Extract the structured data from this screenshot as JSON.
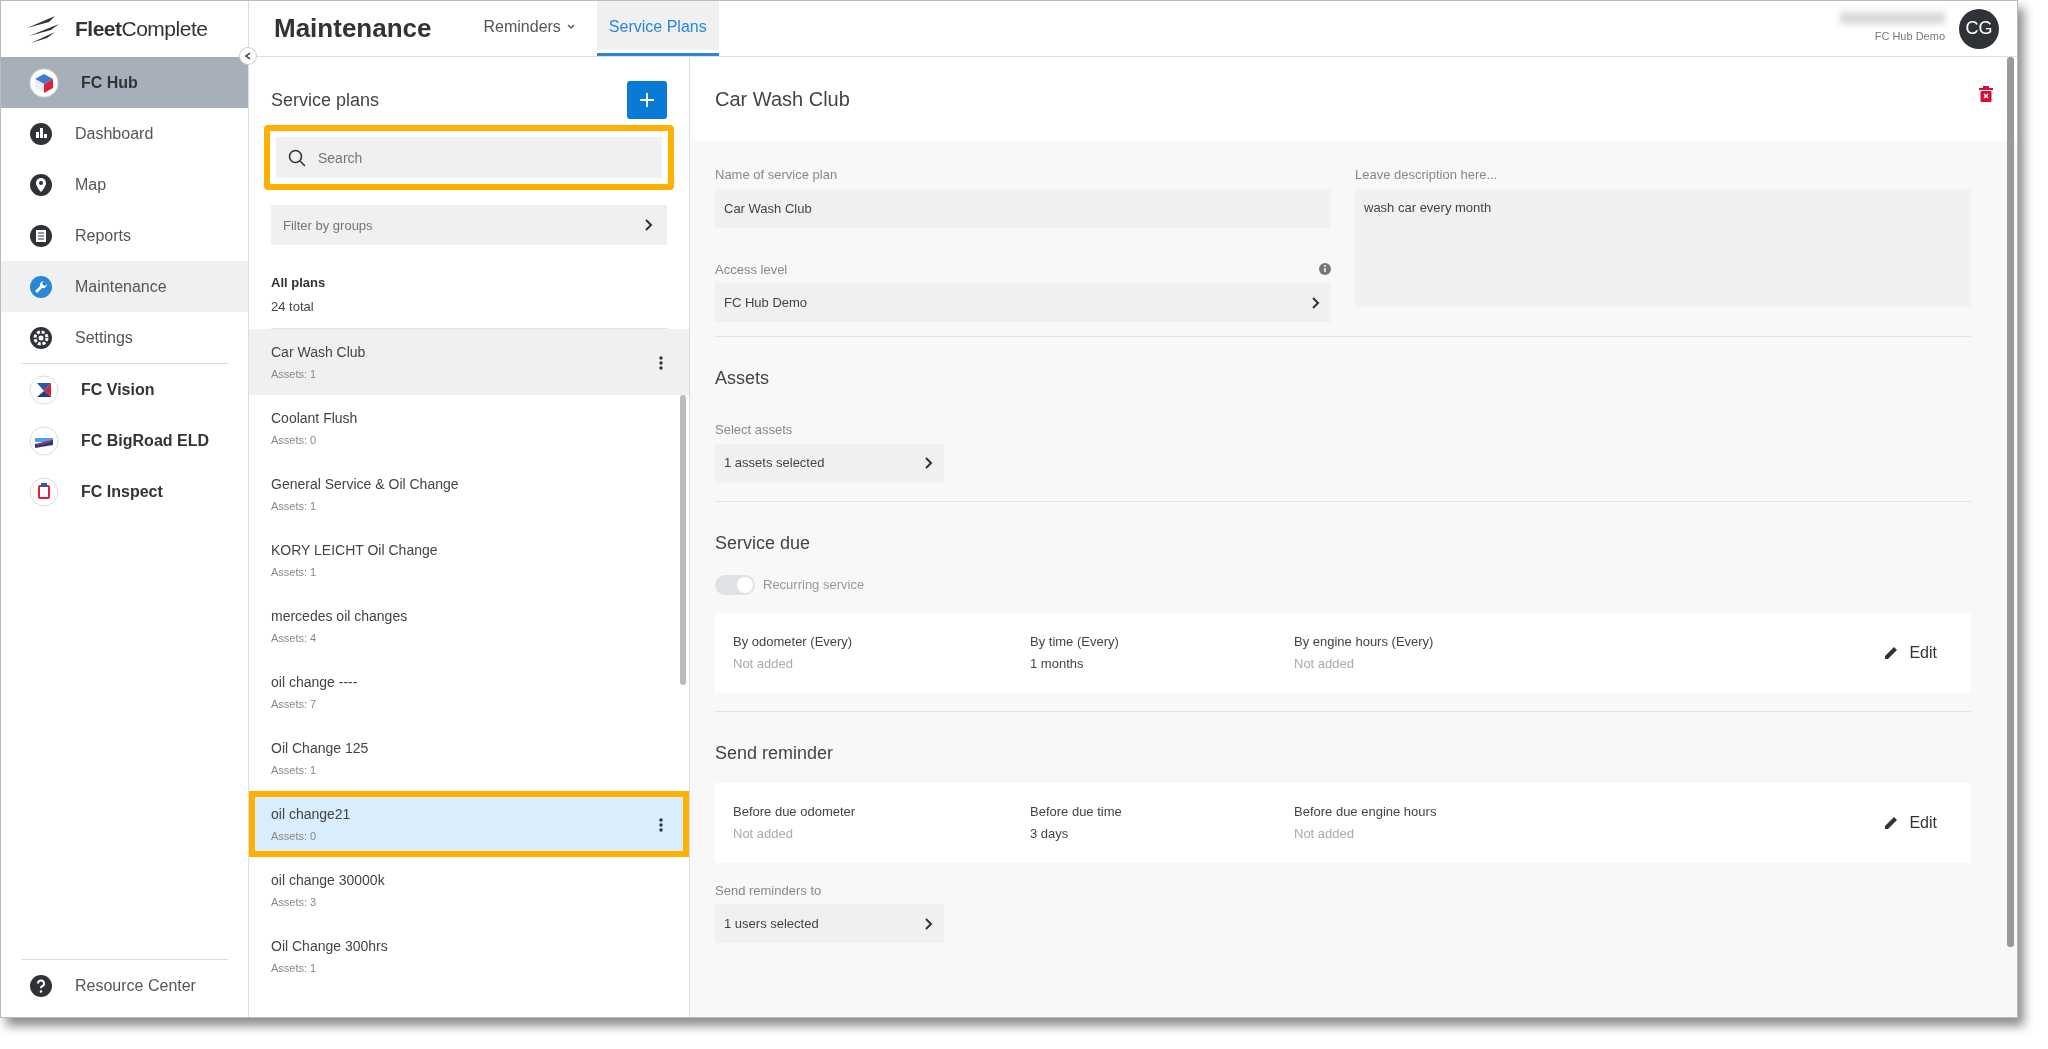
{
  "brand": {
    "name": "**Fleet**Complete"
  },
  "sidebar": {
    "items": [
      {
        "label": "FC Hub",
        "kind": "app",
        "selected": true
      },
      {
        "label": "Dashboard",
        "kind": "nav",
        "selected": false
      },
      {
        "label": "Map",
        "kind": "nav",
        "selected": false
      },
      {
        "label": "Reports",
        "kind": "nav",
        "selected": false
      },
      {
        "label": "Maintenance",
        "kind": "nav",
        "selected": true
      },
      {
        "label": "Settings",
        "kind": "nav",
        "selected": false
      },
      {
        "label": "FC Vision",
        "kind": "app",
        "selected": false
      },
      {
        "label": "FC BigRoad ELD",
        "kind": "app",
        "selected": false
      },
      {
        "label": "FC Inspect",
        "kind": "app",
        "selected": false
      }
    ],
    "footer": {
      "label": "Resource Center"
    }
  },
  "header": {
    "title": "Maintenance",
    "tabs": [
      {
        "label": "Reminders",
        "dropdown": true,
        "selected": false
      },
      {
        "label": "Service Plans",
        "dropdown": false,
        "selected": true
      }
    ],
    "user": {
      "org": "FC Hub Demo",
      "initials": "CG"
    }
  },
  "plans_panel": {
    "title": "Service plans",
    "search": {
      "placeholder": "Search",
      "outlined": true
    },
    "filter": {
      "placeholder": "Filter by groups"
    },
    "summary": {
      "title": "All plans",
      "total": "24 total"
    },
    "plans": [
      {
        "name": "Car Wash Club",
        "assets": "Assets: 1",
        "selected": true,
        "hovered": false,
        "outlined": false
      },
      {
        "name": "Coolant Flush",
        "assets": "Assets: 0",
        "selected": false,
        "hovered": false,
        "outlined": false
      },
      {
        "name": "General Service & Oil Change",
        "assets": "Assets: 1",
        "selected": false,
        "hovered": false,
        "outlined": false
      },
      {
        "name": "KORY LEICHT Oil Change",
        "assets": "Assets: 1",
        "selected": false,
        "hovered": false,
        "outlined": false
      },
      {
        "name": "mercedes oil changes",
        "assets": "Assets: 4",
        "selected": false,
        "hovered": false,
        "outlined": false
      },
      {
        "name": "oil change ----",
        "assets": "Assets: 7",
        "selected": false,
        "hovered": false,
        "outlined": false
      },
      {
        "name": "Oil Change 125",
        "assets": "Assets: 1",
        "selected": false,
        "hovered": false,
        "outlined": false
      },
      {
        "name": "oil change21",
        "assets": "Assets: 0",
        "selected": false,
        "hovered": true,
        "outlined": true
      },
      {
        "name": "oil change 30000k",
        "assets": "Assets: 3",
        "selected": false,
        "hovered": false,
        "outlined": false
      },
      {
        "name": "Oil Change 300hrs",
        "assets": "Assets: 1",
        "selected": false,
        "hovered": false,
        "outlined": false
      }
    ]
  },
  "detail": {
    "title": "Car Wash Club",
    "name_field": {
      "label": "Name of service plan",
      "value": "Car Wash Club"
    },
    "access_field": {
      "label": "Access level",
      "value": "FC Hub Demo"
    },
    "description_field": {
      "label": "Leave description here...",
      "value": "wash car every month"
    },
    "assets": {
      "title": "Assets",
      "select_label": "Select assets",
      "select_value": "1 assets selected"
    },
    "service_due": {
      "title": "Service due",
      "recurring": {
        "label": "Recurring service",
        "on": true,
        "disabled": true
      },
      "cells": [
        {
          "label": "By odometer (Every)",
          "value": "Not added",
          "added": false
        },
        {
          "label": "By time (Every)",
          "value": "1 months",
          "added": true
        },
        {
          "label": "By engine hours (Every)",
          "value": "Not added",
          "added": false
        }
      ],
      "edit": "Edit"
    },
    "send_reminder": {
      "title": "Send reminder",
      "cells": [
        {
          "label": "Before due odometer",
          "value": "Not added",
          "added": false
        },
        {
          "label": "Before due time",
          "value": "3 days",
          "added": true
        },
        {
          "label": "Before due engine hours",
          "value": "Not added",
          "added": false
        }
      ],
      "edit": "Edit",
      "recipients_label": "Send reminders to",
      "recipients_value": "1 users selected"
    }
  }
}
